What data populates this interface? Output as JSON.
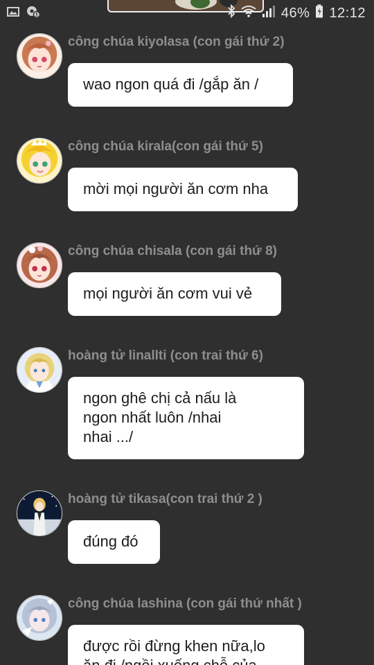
{
  "status_bar": {
    "left_icons": [
      "image-icon",
      "settings-notification-icon"
    ],
    "battery": "46%",
    "time": "12:12",
    "icons": [
      "bluetooth-icon",
      "wifi-icon",
      "signal-icon",
      "battery-icon"
    ]
  },
  "messages": [
    {
      "sender": "công chúa kiyolasa (con gái  thứ 2)",
      "text": "wao ngon quá đi /gắp ăn /",
      "avatar": "avatar-kiyolasa"
    },
    {
      "sender": "công chúa kirala(con gái thứ 5)",
      "text": "mời mọi người ăn cơm nha",
      "avatar": "avatar-kirala"
    },
    {
      "sender": "công chúa chisala (con gái thứ 8)",
      "text": "mọi người ăn cơm vui vẻ",
      "avatar": "avatar-chisala"
    },
    {
      "sender": "hoàng tử linallti (con trai thứ 6)",
      "text": "ngon ghê chị cả nấu là\nngon nhất luôn /nhai\nnhai .../",
      "avatar": "avatar-linallti"
    },
    {
      "sender": "hoàng tử tikasa(con trai thứ 2 )",
      "text": "đúng đó",
      "avatar": "avatar-tikasa"
    },
    {
      "sender": "công chúa lashina (con gái thứ nhất )",
      "text": "được rồi đừng khen nữa,lo\năn đi /ngồi xuống chỗ của",
      "avatar": "avatar-lashina"
    }
  ],
  "colors": {
    "background": "#2f2f2f",
    "bubble": "#ffffff",
    "sender_text": "#8e8e8e",
    "message_text": "#1d1d1d",
    "status_text": "#e6e6e6"
  }
}
